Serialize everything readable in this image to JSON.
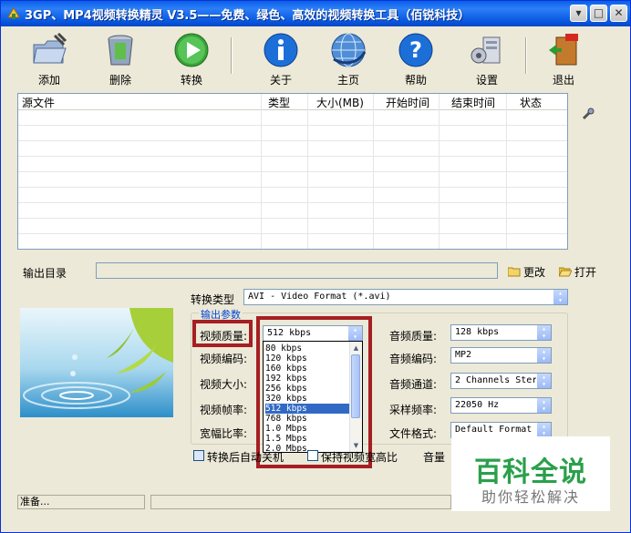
{
  "window": {
    "title": "3GP、MP4视频转换精灵 V3.5——免费、绿色、高效的视频转换工具（佰锐科技）"
  },
  "toolbar": {
    "add": "添加",
    "delete": "删除",
    "convert": "转换",
    "about": "关于",
    "home": "主页",
    "help": "帮助",
    "settings": "设置",
    "exit": "退出"
  },
  "filelist": {
    "columns": [
      "源文件",
      "类型",
      "大小(MB)",
      "开始时间",
      "结束时间",
      "状态"
    ]
  },
  "output": {
    "label": "输出目录",
    "path": "",
    "change": "更改",
    "open": "打开"
  },
  "convert_type": {
    "label": "转换类型",
    "value": "AVI - Video Format (*.avi)"
  },
  "group_title": "输出参数",
  "video": {
    "quality_label": "视频质量:",
    "quality_value": "512 kbps",
    "codec_label": "视频编码:",
    "size_label": "视频大小:",
    "fps_label": "视频帧率:",
    "aspect_label": "宽幅比率:"
  },
  "audio": {
    "quality_label": "音频质量:",
    "quality_value": "128 kbps",
    "codec_label": "音频编码:",
    "codec_value": "MP2",
    "channels_label": "音频通道:",
    "channels_value": "2 Channels Stere",
    "samplerate_label": "采样频率:",
    "samplerate_value": "22050 Hz",
    "format_label": "文件格式:",
    "format_value": "Default Format"
  },
  "dropdown": {
    "options": [
      "80  kbps",
      "120 kbps",
      "160 kbps",
      "192 kbps",
      "256 kbps",
      "320 kbps",
      "512 kbps",
      "768 kbps",
      "1.0 Mbps",
      "1.5 Mbps",
      "2.0 Mbps"
    ],
    "selected_index": 6
  },
  "options": {
    "shutdown": "转换后自动关机",
    "keep_aspect": "保持视频宽高比",
    "volume": "音量"
  },
  "status": {
    "text": "准备..."
  },
  "watermark": {
    "line1": "百科全说",
    "line2": "助你轻松解决"
  },
  "colors": {
    "title_bar": "#0a5ee8",
    "highlight": "#a51f23",
    "selection": "#316ac5",
    "watermark_green": "#2aa04a"
  }
}
